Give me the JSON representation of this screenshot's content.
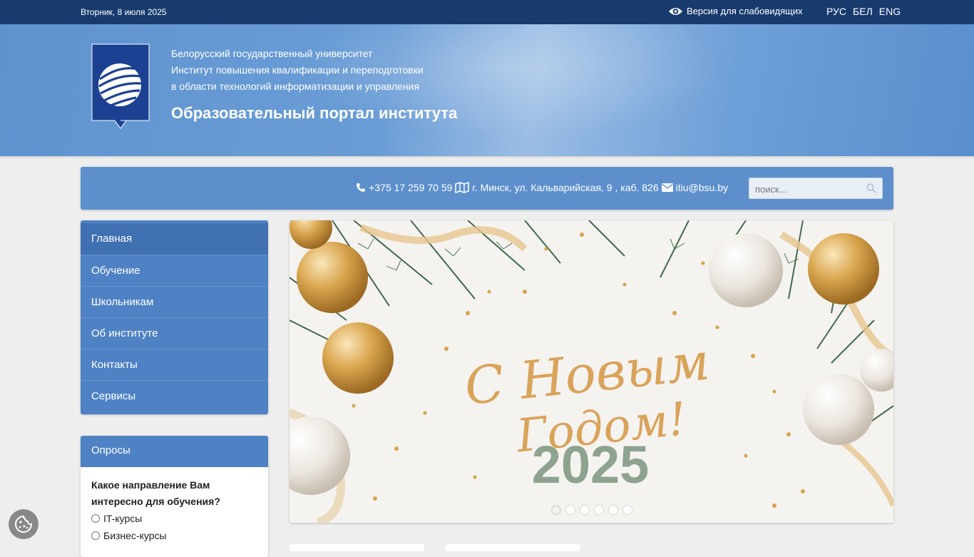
{
  "topbar": {
    "date": "Вторник, 8 июля 2025",
    "vision_label": "Версия для слабовидящих",
    "languages": [
      "РУС",
      "БЕЛ",
      "ENG"
    ]
  },
  "header": {
    "line1": "Белорусский государственный университет",
    "line2": "Институт повышения квалификации и переподготовки",
    "line3": "в области технологий информатизации и управления",
    "portal_title": "Образовательный портал института"
  },
  "contacts": {
    "phone": "+375 17 259 70 59",
    "address": "г. Минск, ул. Кальварийская, 9 , каб. 826",
    "email": "itiu@bsu.by"
  },
  "search": {
    "placeholder": "поиск..."
  },
  "menu": {
    "items": [
      {
        "label": "Главная",
        "active": true
      },
      {
        "label": "Обучение"
      },
      {
        "label": "Школьникам"
      },
      {
        "label": "Об институте"
      },
      {
        "label": "Контакты"
      },
      {
        "label": "Сервисы"
      }
    ]
  },
  "polls": {
    "title": "Опросы",
    "question": "Какое направление Вам интересно для обучения?",
    "options": [
      "IT-курсы",
      "Бизнес-курсы"
    ]
  },
  "banner": {
    "greeting_line1": "С Новым",
    "greeting_line2": "Годом!",
    "year": "2025",
    "slides_count": 6,
    "active_slide": 1
  },
  "colors": {
    "topbar": "#183b6e",
    "header": "#5f93cf",
    "menu": "#4f82c4",
    "menu_active": "#3f70b2",
    "gold": "#d4a04a",
    "pine": "#2f5a3a"
  }
}
